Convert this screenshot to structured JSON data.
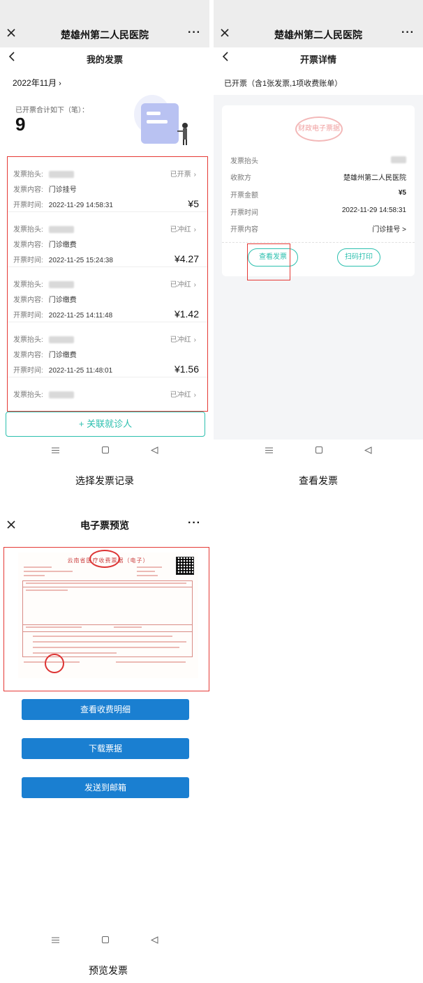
{
  "panel1": {
    "wx_title": "楚雄州第二人民医院",
    "more": "···",
    "page_title": "我的发票",
    "month": "2022年11月",
    "summary_label": "已开票合计如下（笔）：",
    "summary_count": "9",
    "records": [
      {
        "header_label": "发票抬头:",
        "status": "已开票",
        "content_label": "发票内容:",
        "content": "门诊挂号",
        "time_label": "开票时间:",
        "time": "2022-11-29 14:58:31",
        "amount": "¥5"
      },
      {
        "header_label": "发票抬头:",
        "status": "已冲红",
        "content_label": "发票内容:",
        "content": "门诊缴费",
        "time_label": "开票时间:",
        "time": "2022-11-25 15:24:38",
        "amount": "¥4.27"
      },
      {
        "header_label": "发票抬头:",
        "status": "已冲红",
        "content_label": "发票内容:",
        "content": "门诊缴费",
        "time_label": "开票时间:",
        "time": "2022-11-25 14:11:48",
        "amount": "¥1.42"
      },
      {
        "header_label": "发票抬头:",
        "status": "已冲红",
        "content_label": "发票内容:",
        "content": "门诊缴费",
        "time_label": "开票时间:",
        "time": "2022-11-25 11:48:01",
        "amount": "¥1.56"
      },
      {
        "header_label": "发票抬头:",
        "status": "已冲红",
        "content_label": "",
        "content": "",
        "time_label": "",
        "time": "",
        "amount": ""
      }
    ],
    "assoc_button": "+ 关联就诊人",
    "caption": "选择发票记录"
  },
  "panel2": {
    "wx_title": "楚雄州第二人民医院",
    "more": "···",
    "page_title": "开票详情",
    "header": "已开票（含1张发票,1项收费账单）",
    "stamp_text": "财政电子票据",
    "rows": [
      {
        "label": "发票抬头",
        "value": ""
      },
      {
        "label": "收款方",
        "value": "楚雄州第二人民医院"
      },
      {
        "label": "开票金额",
        "value": "¥5"
      },
      {
        "label": "开票时间",
        "value": "2022-11-29 14:58:31"
      },
      {
        "label": "开票内容",
        "value": "门诊挂号 >"
      }
    ],
    "view_button": "查看发票",
    "print_button": "扫码打印",
    "caption": "查看发票"
  },
  "panel3": {
    "wx_title": "电子票预览",
    "more": "···",
    "doc_title": "云南省医疗收费票据（电子）",
    "buttons": [
      "查看收费明细",
      "下载票据",
      "发送到邮箱"
    ],
    "caption": "预览发票"
  },
  "colors": {
    "accent_teal": "#2bbfae",
    "highlight_red": "#e53935",
    "button_blue": "#1a7fd1",
    "wechat_bar": "#ededed"
  },
  "icons": [
    "close-icon",
    "more-icon",
    "back-icon",
    "chevron-right-icon",
    "menu-icon",
    "home-icon",
    "nav-back-icon"
  ]
}
